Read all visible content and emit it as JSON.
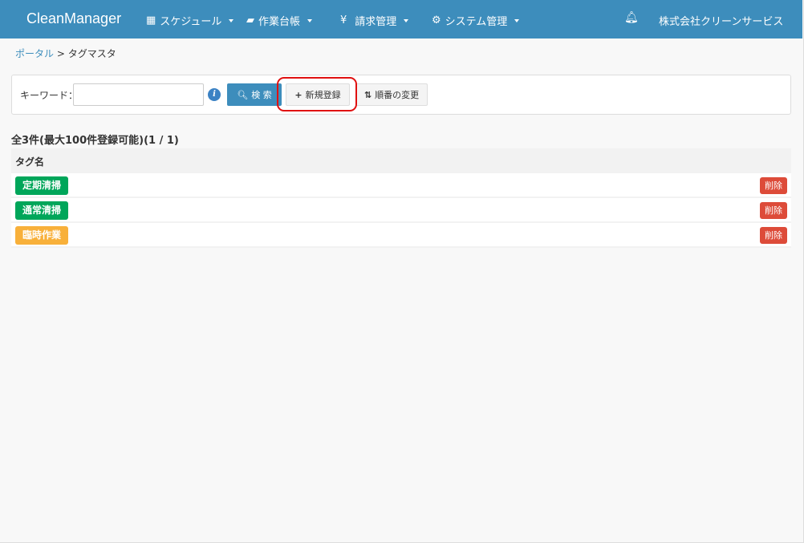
{
  "app": {
    "title": "CleanManager",
    "company": "株式会社クリーンサービス"
  },
  "menu": [
    {
      "label": "スケジュール",
      "icon": "calendar-icon"
    },
    {
      "label": "作業台帳",
      "icon": "book-icon"
    },
    {
      "label": "請求管理",
      "icon": "yen-icon"
    },
    {
      "label": "システム管理",
      "icon": "gears-icon"
    }
  ],
  "breadcrumb": {
    "home": "ポータル",
    "sep": ">",
    "current": "タグマスタ"
  },
  "search": {
    "keyword_label": "キーワード：",
    "keyword_value": "",
    "search_label": "検 索",
    "new_label": "新規登録",
    "order_label": "順番の変更"
  },
  "summary": "全3件(最大100件登録可能)(1 / 1)",
  "table": {
    "header": "タグ名",
    "delete_label": "削除",
    "rows": [
      {
        "name": "定期清掃",
        "color": "#00a65a"
      },
      {
        "name": "通常清掃",
        "color": "#00a65a"
      },
      {
        "name": "臨時作業",
        "color": "#f8b03a"
      }
    ]
  }
}
